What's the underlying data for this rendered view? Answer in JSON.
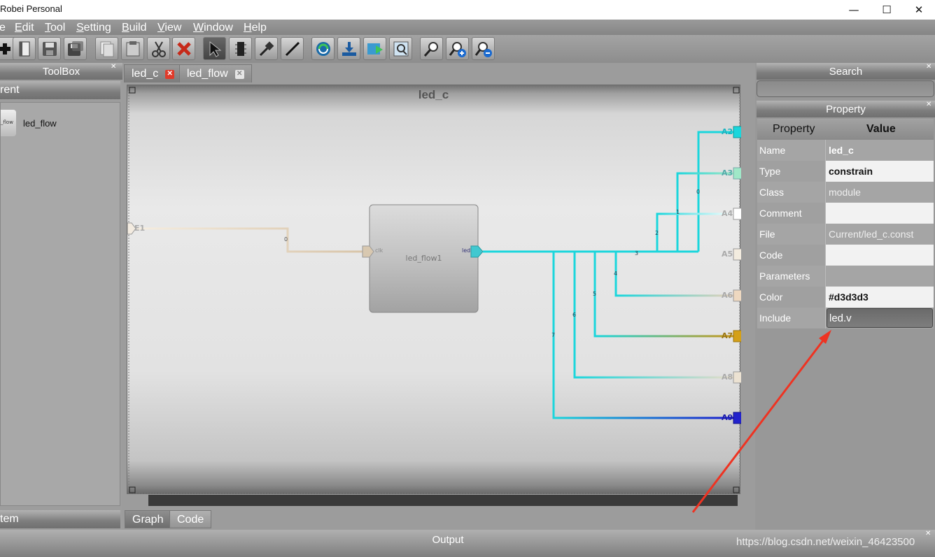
{
  "window": {
    "title": "Robei  Personal",
    "minimize": "—",
    "maximize": "☐",
    "close": "✕"
  },
  "menu": [
    "e",
    "Edit",
    "Tool",
    "Setting",
    "Build",
    "View",
    "Window",
    "Help"
  ],
  "menu_underlines": [
    "",
    "E",
    "T",
    "S",
    "B",
    "V",
    "W",
    "H"
  ],
  "toolbar_icons": [
    "add-icon",
    "book-icon",
    "save-icon",
    "save-all-icon",
    "copy-icon",
    "paste-icon",
    "cut-icon",
    "delete-icon",
    "select-arrow-icon",
    "chip-icon",
    "pin-icon",
    "wire-icon",
    "run-icon",
    "download-icon",
    "simulate-icon",
    "zoom-fit-icon",
    "magnifier-icon",
    "zoom-in-icon",
    "zoom-out-icon"
  ],
  "toolbox": {
    "title": "ToolBox",
    "current_label": "rent",
    "item_label": "led_flow",
    "item_thumb_text": "_flow",
    "system_label": "tem"
  },
  "tabs": [
    {
      "label": "led_c"
    },
    {
      "label": "led_flow"
    }
  ],
  "bottom_tabs": [
    "Graph",
    "Code"
  ],
  "diagram": {
    "title": "led_c",
    "module_name": "led_flow1",
    "module_in_port": "clk",
    "module_out_port": "led",
    "input_port": "E1",
    "input_wire_label": "0",
    "outputs": [
      "A2",
      "A3",
      "A4",
      "A5",
      "A6",
      "A7",
      "A8",
      "A9"
    ],
    "wire_labels": [
      "0",
      "1",
      "2",
      "3",
      "4",
      "5",
      "6",
      "7"
    ]
  },
  "search": {
    "title": "Search"
  },
  "property": {
    "title": "Property",
    "col_property": "Property",
    "col_value": "Value",
    "rows": [
      {
        "k": "Name",
        "v": "led_c"
      },
      {
        "k": "Type",
        "v": "constrain"
      },
      {
        "k": "Class",
        "v": "module"
      },
      {
        "k": "Comment",
        "v": ""
      },
      {
        "k": "File",
        "v": "Current/led_c.const"
      },
      {
        "k": "Code",
        "v": ""
      },
      {
        "k": "Parameters",
        "v": ""
      },
      {
        "k": "Color",
        "v": "#d3d3d3"
      },
      {
        "k": "Include",
        "v": "led.v"
      }
    ]
  },
  "output": {
    "title": "Output"
  },
  "watermark": "https://blog.csdn.net/weixin_46423500",
  "colors": {
    "accent_cyan": "#1ad6dc",
    "arrow_red": "#ee3322",
    "a7_gold": "#d4a017",
    "a9_blue": "#2222cc"
  }
}
